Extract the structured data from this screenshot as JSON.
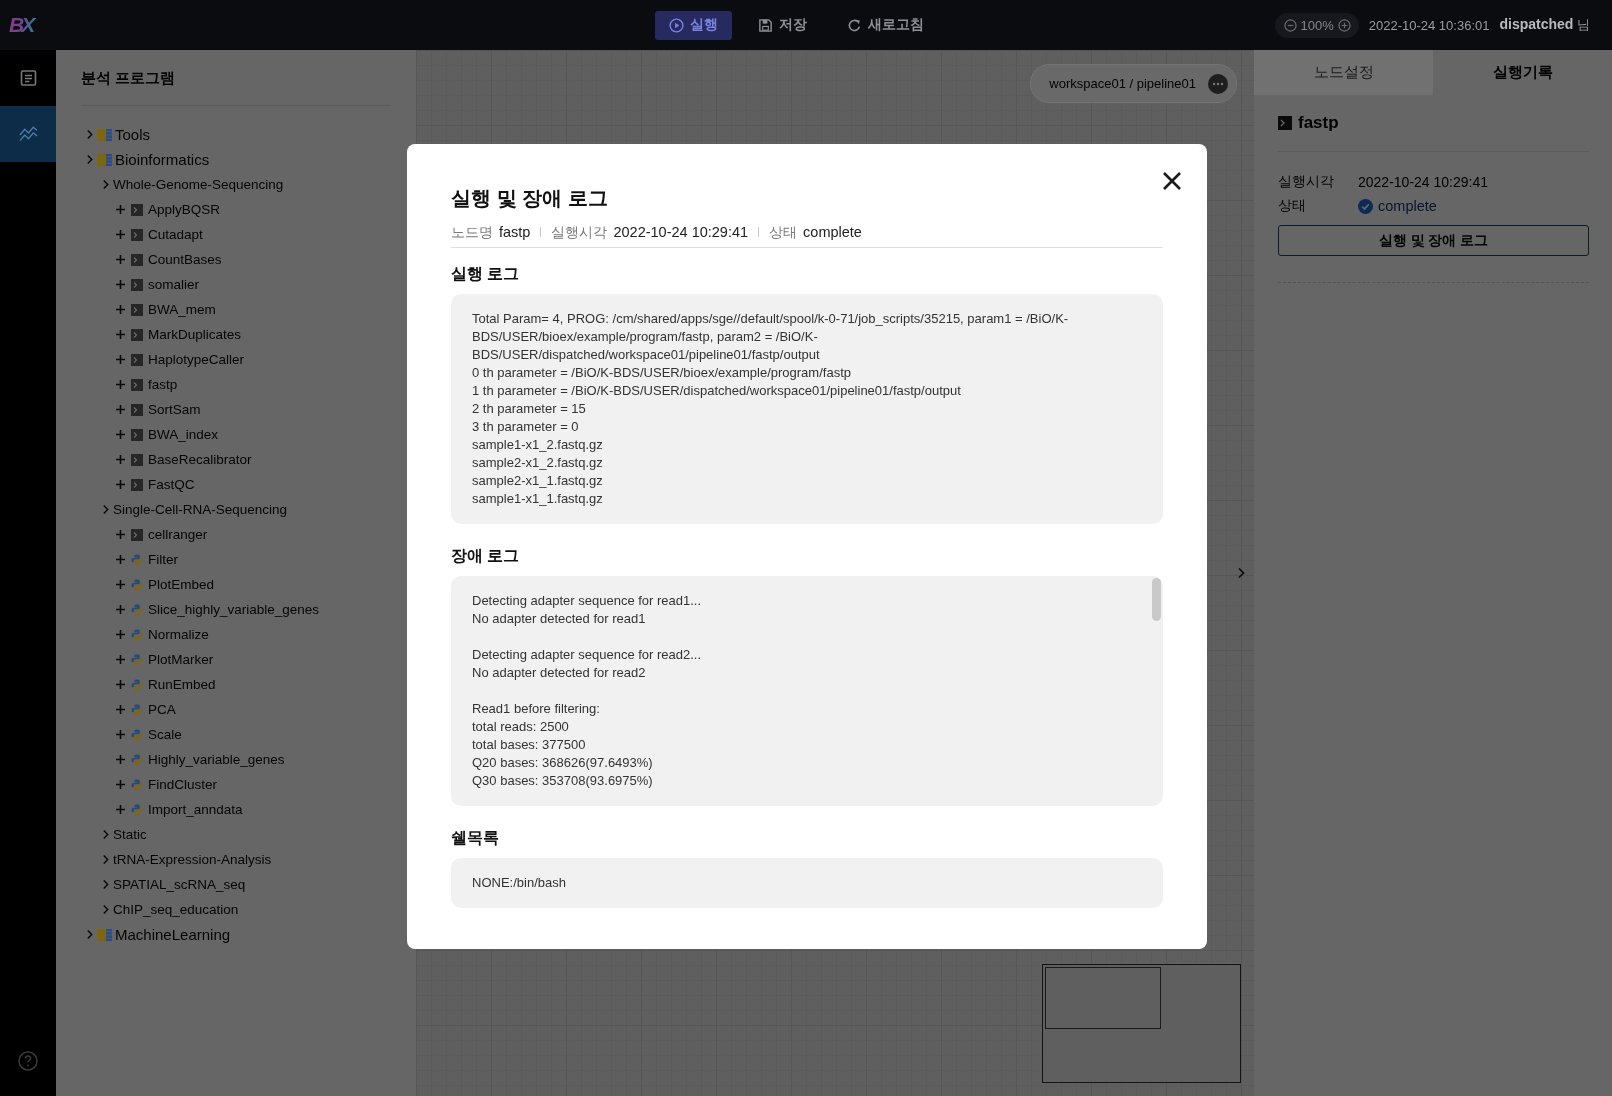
{
  "top_bar": {
    "logo": "BX",
    "buttons": [
      {
        "label": "실행",
        "kind": "play",
        "selected": true
      },
      {
        "label": "저장",
        "kind": "save",
        "selected": false
      },
      {
        "label": "새로고침",
        "kind": "refresh",
        "selected": false
      }
    ],
    "zoom": "100%",
    "datetime": "2022-10-24 10:36:01",
    "user": "**dispatched** 님"
  },
  "rail": {
    "items": [
      {
        "kind": "document",
        "selected": false
      },
      {
        "kind": "chart",
        "selected": true
      }
    ]
  },
  "sidebar": {
    "title": "분석 프로그램",
    "tree": [
      {
        "label": "Tools",
        "kind": "category"
      },
      {
        "label": "Bioinformatics",
        "kind": "category",
        "children": [
          {
            "label": "Whole-Genome-Sequencing",
            "kind": "group",
            "children": [
              {
                "label": "ApplyBQSR",
                "kind": "terminal"
              },
              {
                "label": "Cutadapt",
                "kind": "terminal"
              },
              {
                "label": "CountBases",
                "kind": "terminal"
              },
              {
                "label": "somalier",
                "kind": "terminal"
              },
              {
                "label": "BWA_mem",
                "kind": "terminal"
              },
              {
                "label": "MarkDuplicates",
                "kind": "terminal"
              },
              {
                "label": "HaplotypeCaller",
                "kind": "terminal"
              },
              {
                "label": "fastp",
                "kind": "terminal"
              },
              {
                "label": "SortSam",
                "kind": "terminal"
              },
              {
                "label": "BWA_index",
                "kind": "terminal"
              },
              {
                "label": "BaseRecalibrator",
                "kind": "terminal"
              },
              {
                "label": "FastQC",
                "kind": "terminal"
              }
            ]
          },
          {
            "label": "Single-Cell-RNA-Sequencing",
            "kind": "group",
            "children": [
              {
                "label": "cellranger",
                "kind": "terminal"
              },
              {
                "label": "Filter",
                "kind": "python"
              },
              {
                "label": "PlotEmbed",
                "kind": "python"
              },
              {
                "label": "Slice_highly_variable_genes",
                "kind": "python"
              },
              {
                "label": "Normalize",
                "kind": "python"
              },
              {
                "label": "PlotMarker",
                "kind": "python"
              },
              {
                "label": "RunEmbed",
                "kind": "python"
              },
              {
                "label": "PCA",
                "kind": "python"
              },
              {
                "label": "Scale",
                "kind": "python"
              },
              {
                "label": "Highly_variable_genes",
                "kind": "python"
              },
              {
                "label": "FindCluster",
                "kind": "python"
              },
              {
                "label": "Import_anndata",
                "kind": "python"
              }
            ]
          },
          {
            "label": "Static",
            "kind": "group"
          },
          {
            "label": "tRNA-Expression-Analysis",
            "kind": "group"
          },
          {
            "label": "SPATIAL_scRNA_seq",
            "kind": "group"
          },
          {
            "label": "ChIP_seq_education",
            "kind": "group"
          }
        ]
      },
      {
        "label": "MachineLearning",
        "kind": "category"
      }
    ]
  },
  "canvas": {
    "breadcrumb": "workspace01 / pipeline01"
  },
  "right_panel": {
    "tabs": [
      {
        "label": "노드설정",
        "selected": false
      },
      {
        "label": "실행기록",
        "selected": true
      }
    ],
    "node": {
      "title": "fastp",
      "fields": [
        {
          "label": "실행시각",
          "value": "2022-10-24 10:29:41",
          "kind": "text"
        },
        {
          "label": "상태",
          "value": "complete",
          "kind": "status"
        }
      ],
      "button": "실행 및 장애 로그"
    }
  },
  "modal": {
    "title": "실행 및 장애 로그",
    "meta": [
      {
        "label": "노드명",
        "value": "fastp"
      },
      {
        "label": "실행시각",
        "value": "2022-10-24 10:29:41"
      },
      {
        "label": "상태",
        "value": "complete"
      }
    ],
    "sections": [
      {
        "heading": "실행 로그",
        "scrollable": false,
        "paragraphs": [
          [
            "Total Param= 4, PROG: /cm/shared/apps/sge//default/spool/k-0-71/job_scripts/35215, param1 = /BiO/K-BDS/USER/bioex/example/program/fastp, param2 = /BiO/K-BDS/USER/dispatched/workspace01/pipeline01/fastp/output",
            "0 th parameter = /BiO/K-BDS/USER/bioex/example/program/fastp",
            "1 th parameter = /BiO/K-BDS/USER/dispatched/workspace01/pipeline01/fastp/output",
            "2 th parameter = 15",
            "3 th parameter = 0",
            "sample1-x1_2.fastq.gz",
            "sample2-x1_2.fastq.gz",
            "sample2-x1_1.fastq.gz",
            "sample1-x1_1.fastq.gz"
          ]
        ]
      },
      {
        "heading": "장애 로그",
        "scrollable": true,
        "paragraphs": [
          [
            "Detecting adapter sequence for read1...",
            "No adapter detected for read1"
          ],
          [
            "Detecting adapter sequence for read2...",
            "No adapter detected for read2"
          ],
          [
            "Read1 before filtering:",
            "total reads: 2500",
            "total bases: 377500",
            "Q20 bases: 368626(97.6493%)",
            "Q30 bases: 353708(93.6975%)"
          ]
        ]
      },
      {
        "heading": "쉘목록",
        "scrollable": false,
        "paragraphs": [
          [
            "NONE:/bin/bash"
          ]
        ]
      }
    ]
  }
}
